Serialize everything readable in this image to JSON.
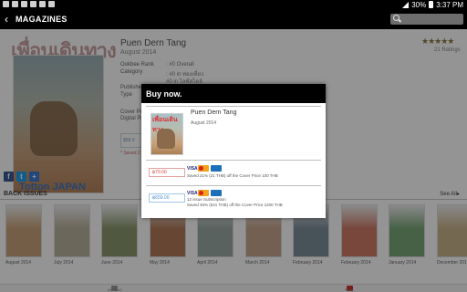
{
  "status_bar": {
    "battery": "30%",
    "time": "3:37 PM"
  },
  "action_bar": {
    "back_icon": "chevron-left-icon",
    "title": "MAGAZINES"
  },
  "magazine": {
    "cover_masthead": "เพื่อนเดินทาง",
    "cover_headline": "Totton JAPAN",
    "title": "Puen Dern Tang",
    "date": "August 2014",
    "stars": "★★★★★",
    "ratings": "21 Ratings",
    "rank_label": "Ookbee Rank",
    "rank_value": ": #0 Overall",
    "category_label": "Category",
    "category_value": ": #0 in ท่องเที่ยว",
    "category_value2": "#0 in ไลฟ์สไตล์",
    "publisher_label": "Publisher",
    "type_label": "Type",
    "cover_price_label": "Cover Price",
    "digital_price_label": "Digital Pr",
    "buy_box_text": "$58.0",
    "saved_text": "* Saved 2"
  },
  "back_issues": {
    "header": "BACK ISSUES",
    "see_all": "See All",
    "items": [
      {
        "label": "August 2014",
        "color": "#c9a37a"
      },
      {
        "label": "July 2014",
        "color": "#b9b19c"
      },
      {
        "label": "June 2014",
        "color": "#8a9a6e"
      },
      {
        "label": "May 2014",
        "color": "#b27a5a"
      },
      {
        "label": "April 2014",
        "color": "#9aa9a2"
      },
      {
        "label": "March 2014",
        "color": "#c8a58e"
      },
      {
        "label": "February 2014",
        "color": "#7c8f9a"
      },
      {
        "label": "February 2014",
        "color": "#d07d6a"
      },
      {
        "label": "January 2014",
        "color": "#7aa77a"
      },
      {
        "label": "December 2013",
        "color": "#c9b48a"
      }
    ]
  },
  "bottom_bar": {
    "left_label": "My Shelf",
    "right_label": "Store"
  },
  "dialog": {
    "title": "Buy now.",
    "cover_masthead": "เพื่อนเดินทาง",
    "name": "Puen Dern Tang",
    "date": "August 2014",
    "options": [
      {
        "price": "฿79.00",
        "offer_lines": [
          "Saved 21% (21 THB) off the Cover Price 100 THB"
        ],
        "style": "red"
      },
      {
        "price": "฿659.00",
        "offer_lines": [
          "12 issue Subscription",
          "Saved 45% (541 THB) off the Cover Price 1200 THB"
        ],
        "style": "blue"
      }
    ],
    "visa_label": "VISA"
  }
}
